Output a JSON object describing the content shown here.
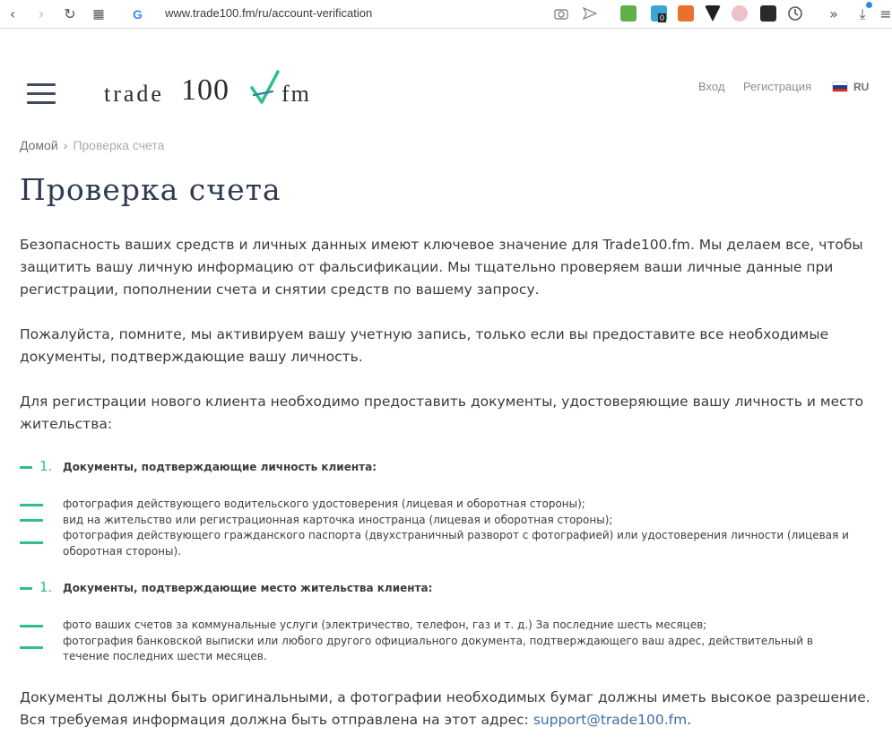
{
  "browser": {
    "url": "www.trade100.fm/ru/account-verification",
    "google_icon": "G",
    "back_icon": "‹",
    "forward_icon": "›",
    "reload_icon": "↻",
    "apps_icon": "▦",
    "more_icon": "»",
    "download_icon": "⤓",
    "menu_icon": "≡",
    "ext_badge": "0"
  },
  "header": {
    "logo_text_left": "trade",
    "logo_number": "100",
    "logo_text_right": "fm",
    "login_label": "Вход",
    "register_label": "Регистрация",
    "language": "RU"
  },
  "breadcrumb": {
    "home": "Домой",
    "separator": "›",
    "current": "Проверка счета"
  },
  "page": {
    "title": "Проверка счета",
    "intro_1": "Безопасность ваших средств и личных данных имеют ключевое значение для Trade100.fm. Мы делаем все, чтобы защитить вашу личную информацию от фальсификации. Мы тщательно проверяем ваши личные данные при регистрации, пополнении счета и снятии средств по вашему запросу.",
    "intro_2": "Пожалуйста, помните, мы активируем вашу учетную запись, только если вы предоставите все необходимые документы, подтверждающие вашу личность.",
    "intro_3": "Для регистрации нового клиента необходимо предоставить документы, удостоверяющие вашу личность и место жительства:",
    "section_1": {
      "number": "1.",
      "heading": "Документы, подтверждающие личность клиента:",
      "items": [
        "фотография действующего водительского удостоверения (лицевая и оборотная стороны);",
        "вид на жительство или регистрационная карточка иностранца (лицевая и оборотная стороны);",
        "фотография действующего гражданского паспорта (двухстраничный разворот с фотографией) или удостоверения личности (лицевая и оборотная стороны)."
      ]
    },
    "section_2": {
      "number": "1.",
      "heading": "Документы, подтверждающие место жительства клиента:",
      "items": [
        "фото ваших счетов за коммунальные услуги (электричество, телефон, газ и т. д.) За последние шесть месяцев;",
        "фотография банковской выписки или любого другого официального документа, подтверждающего ваш адрес, действительный в течение последних шести месяцев."
      ]
    },
    "footer_text": "Документы должны быть оригинальными, а фотографии необходимых бумаг должны иметь высокое разрешение. Вся требуемая информация должна быть отправлена на этот адрес: ",
    "support_email": "support@trade100.fm",
    "footer_end": "."
  },
  "colors": {
    "accent": "#2fbf8f",
    "title": "#2f3b4f",
    "link": "#3f6fa8"
  }
}
